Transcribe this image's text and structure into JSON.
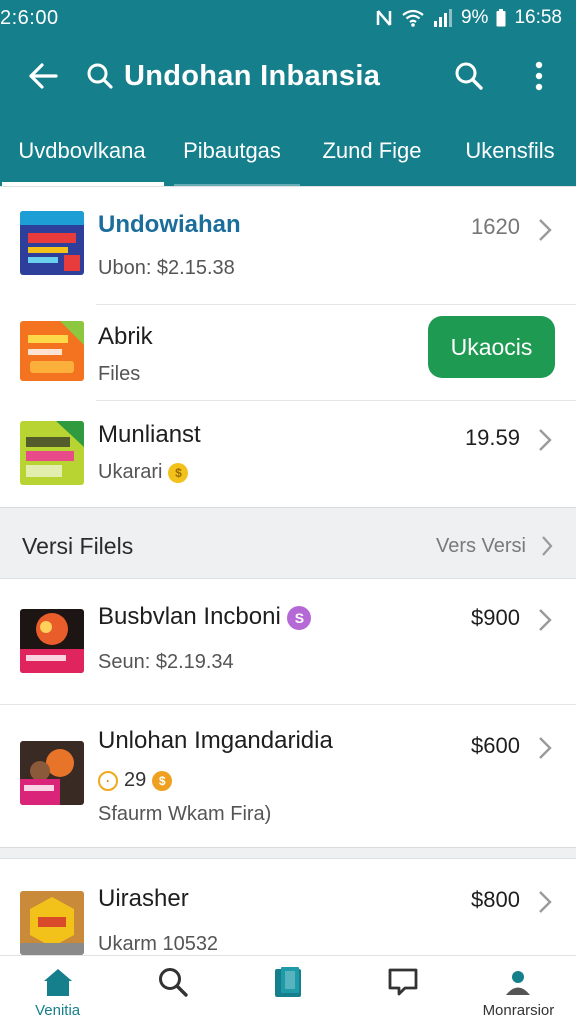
{
  "status_bar": {
    "time": "2:6:00",
    "battery": "9%",
    "right_text": "16:58"
  },
  "app_bar": {
    "title": "Undohan Inbansia"
  },
  "tabs": [
    {
      "label": "Uvdbovlkana"
    },
    {
      "label": "Pibautgas"
    },
    {
      "label": "Zund Fige"
    },
    {
      "label": "Ukensfils"
    }
  ],
  "top_list": [
    {
      "title": "Undowiahan",
      "subtitle": "Ubon: $2.15.38",
      "value": "1620"
    },
    {
      "title": "Abrik",
      "subtitle": "Files",
      "button": "Ukaocis"
    },
    {
      "title": "Munlianst",
      "subtitle": "Ukarari",
      "value": "19.59"
    }
  ],
  "section": {
    "title": "Versi Filels",
    "link": "Vers Versi"
  },
  "bottom_list": [
    {
      "title": "Busbvlan Incboni",
      "subtitle": "Seun: $2.19.34",
      "value": "$900"
    },
    {
      "title": "Unlohan Imgandaridia",
      "meta": "29",
      "subtitle": "Sfaurm Wkam Fira)",
      "value": "$600"
    },
    {
      "title": "Uirasher",
      "subtitle": "Ukarm 10532",
      "value": "$800"
    }
  ],
  "bottom_nav": [
    {
      "label": "Venitia",
      "icon": "home-icon"
    },
    {
      "label": "",
      "icon": "search-icon"
    },
    {
      "label": "",
      "icon": "book-icon"
    },
    {
      "label": "",
      "icon": "chat-icon"
    },
    {
      "label": "Monrarsior",
      "icon": "profile-icon"
    }
  ],
  "colors": {
    "primary": "#167f8c",
    "accent_green": "#1f9a52",
    "title_blue": "#1b6d9c"
  }
}
